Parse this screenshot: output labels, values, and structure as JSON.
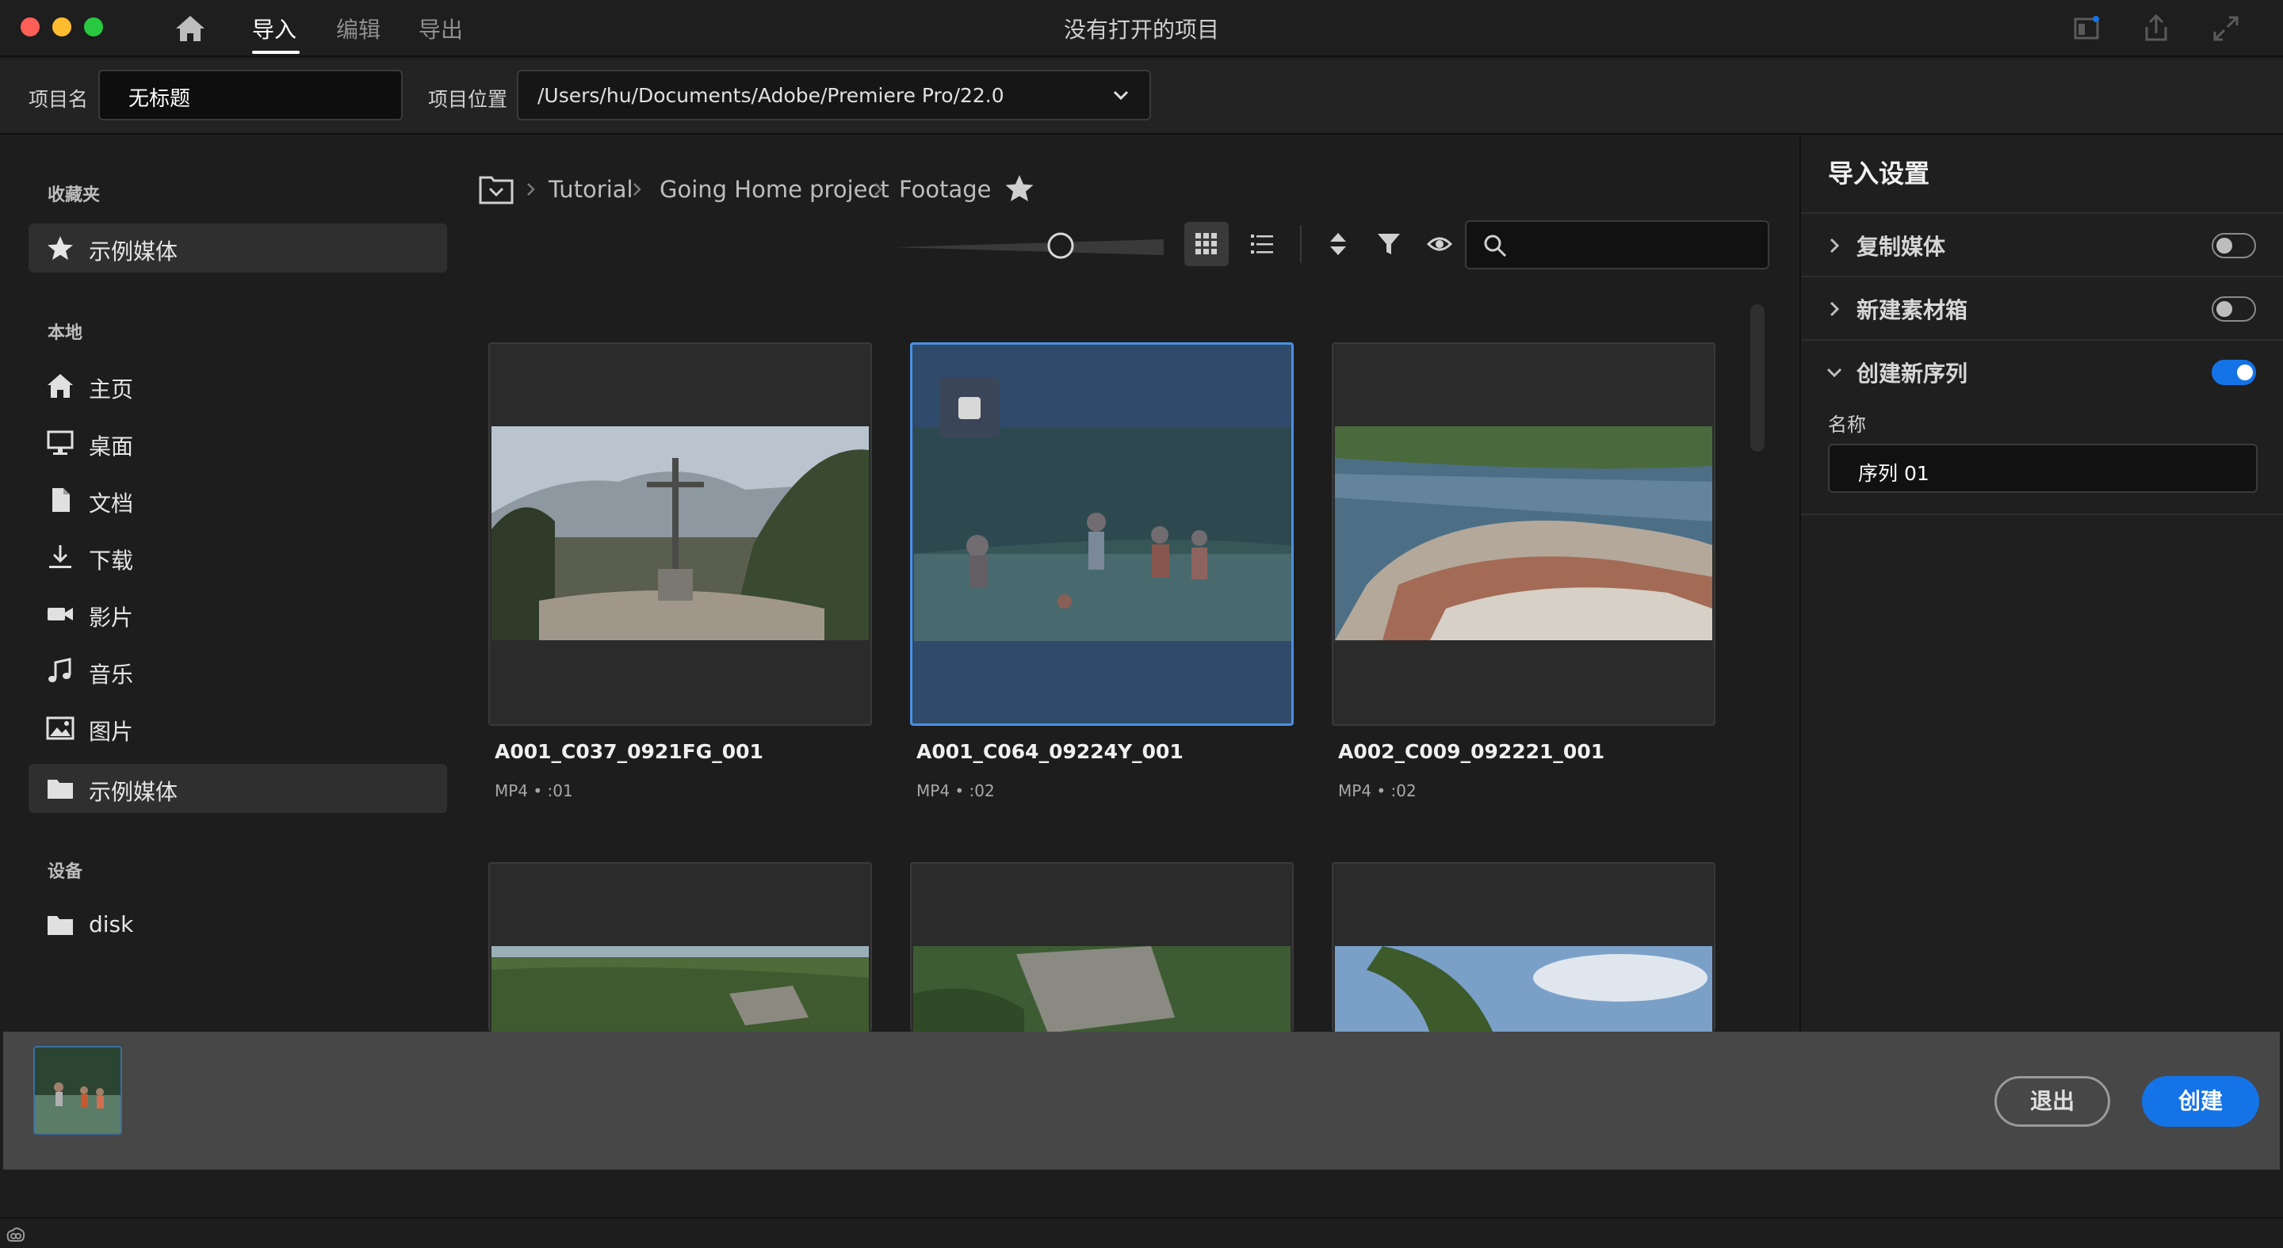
{
  "titlebar": {
    "tabs": [
      "导入",
      "编辑",
      "导出"
    ],
    "active_tab": "导入",
    "window_title": "没有打开的项目"
  },
  "project": {
    "name_label": "项目名",
    "name_value": "无标题",
    "location_label": "项目位置",
    "location_value": "/Users/hu/Documents/Adobe/Premiere Pro/22.0"
  },
  "sidebar": {
    "favorites_heading": "收藏夹",
    "favorites": [
      {
        "label": "示例媒体",
        "icon": "star-icon"
      }
    ],
    "local_heading": "本地",
    "local": [
      {
        "label": "主页",
        "icon": "home-icon"
      },
      {
        "label": "桌面",
        "icon": "desktop-icon"
      },
      {
        "label": "文档",
        "icon": "document-icon"
      },
      {
        "label": "下载",
        "icon": "download-icon"
      },
      {
        "label": "影片",
        "icon": "movie-icon"
      },
      {
        "label": "音乐",
        "icon": "music-icon"
      },
      {
        "label": "图片",
        "icon": "picture-icon"
      },
      {
        "label": "示例媒体",
        "icon": "folder-icon"
      }
    ],
    "devices_heading": "设备",
    "devices": [
      {
        "label": "disk",
        "icon": "folder-icon"
      }
    ]
  },
  "breadcrumb": [
    "Tutorial",
    "Going Home project",
    "Footage"
  ],
  "clips": [
    {
      "name": "A001_C037_0921FG_001",
      "meta": "MP4 • :01",
      "selected": false
    },
    {
      "name": "A001_C064_09224Y_001",
      "meta": "MP4 • :02",
      "selected": true
    },
    {
      "name": "A002_C009_092221_001",
      "meta": "MP4 • :02",
      "selected": false
    }
  ],
  "import_settings": {
    "title": "导入设置",
    "rows": [
      {
        "label": "复制媒体",
        "enabled": false
      },
      {
        "label": "新建素材箱",
        "enabled": false
      },
      {
        "label": "创建新序列",
        "enabled": true
      }
    ],
    "name_label": "名称",
    "name_value": "序列 01"
  },
  "footer": {
    "exit_label": "退出",
    "create_label": "创建"
  },
  "colors": {
    "accent": "#1473e6",
    "selection_border": "#4a90e2"
  }
}
